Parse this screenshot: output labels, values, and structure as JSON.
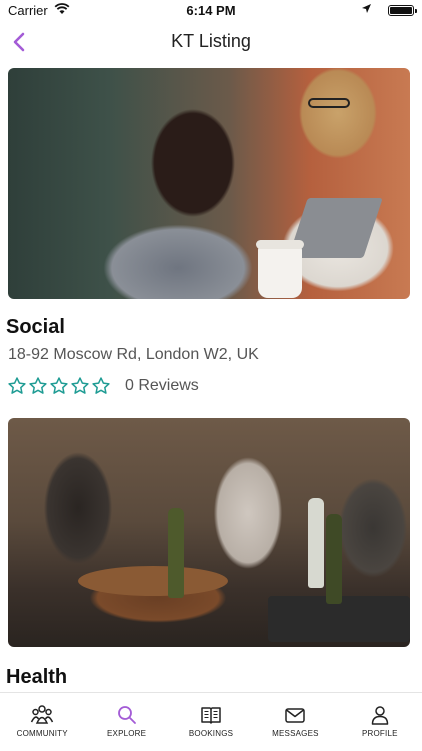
{
  "status_bar": {
    "carrier": "Carrier",
    "time": "6:14 PM"
  },
  "nav": {
    "title": "KT Listing"
  },
  "listings": [
    {
      "name": "Social",
      "address": "18-92 Moscow Rd, London W2, UK",
      "rating": 0,
      "reviews": "0 Reviews"
    },
    {
      "name": "Health"
    }
  ],
  "tabs": [
    {
      "label": "COMMUNITY",
      "icon": "community-icon"
    },
    {
      "label": "EXPLORE",
      "icon": "search-icon"
    },
    {
      "label": "BOOKINGS",
      "icon": "book-icon"
    },
    {
      "label": "MESSAGES",
      "icon": "envelope-icon"
    },
    {
      "label": "PROFILE",
      "icon": "person-icon"
    }
  ],
  "colors": {
    "accent": "#a35bd6",
    "star": "#1f9c94",
    "text_secondary": "#555555"
  }
}
